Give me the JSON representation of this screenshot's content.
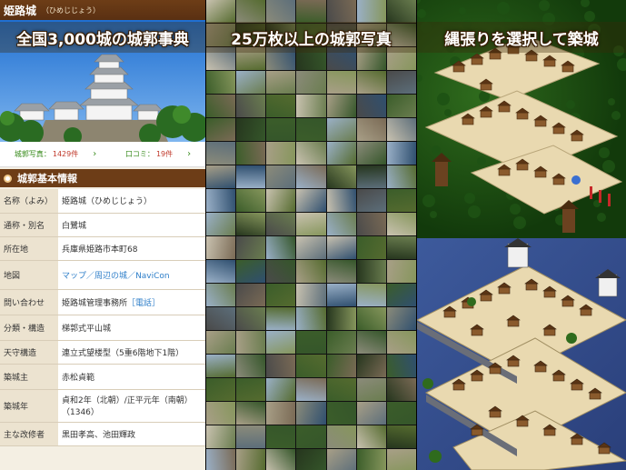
{
  "dict": {
    "castle_name": "姫路城",
    "castle_reading": "（ひめじじょう）",
    "banner": "全国3,000城の城郭事典",
    "stats": [
      {
        "label": "城郭写真：",
        "count": "1429件"
      },
      {
        "label": "口コミ：",
        "count": "19件"
      }
    ],
    "section_title": "城郭基本情報",
    "rows": [
      {
        "key": "名称（よみ）",
        "value": "姫路城（ひめじじょう）"
      },
      {
        "key": "通称・別名",
        "value": "白鷺城"
      },
      {
        "key": "所在地",
        "value": "兵庫県姫路市本町68"
      },
      {
        "key": "地図",
        "links": [
          "マップ",
          "周辺の城",
          "NaviCon"
        ],
        "separator": "／"
      },
      {
        "key": "問い合わせ",
        "value": "姫路城管理事務所",
        "link": "［電話］"
      },
      {
        "key": "分類・構造",
        "value": "梯郭式平山城"
      },
      {
        "key": "天守構造",
        "value": "連立式望楼型（5重6階地下1階）"
      },
      {
        "key": "築城主",
        "value": "赤松貞範"
      },
      {
        "key": "築城年",
        "value": "貞和2年（北朝）/正平元年（南朝）（1346）"
      },
      {
        "key": "主な改修者",
        "value": "黒田孝高、池田輝政"
      }
    ]
  },
  "photos": {
    "banner": "25万枚以上の城郭写真"
  },
  "game": {
    "banner": "縄張りを選択して築城"
  }
}
